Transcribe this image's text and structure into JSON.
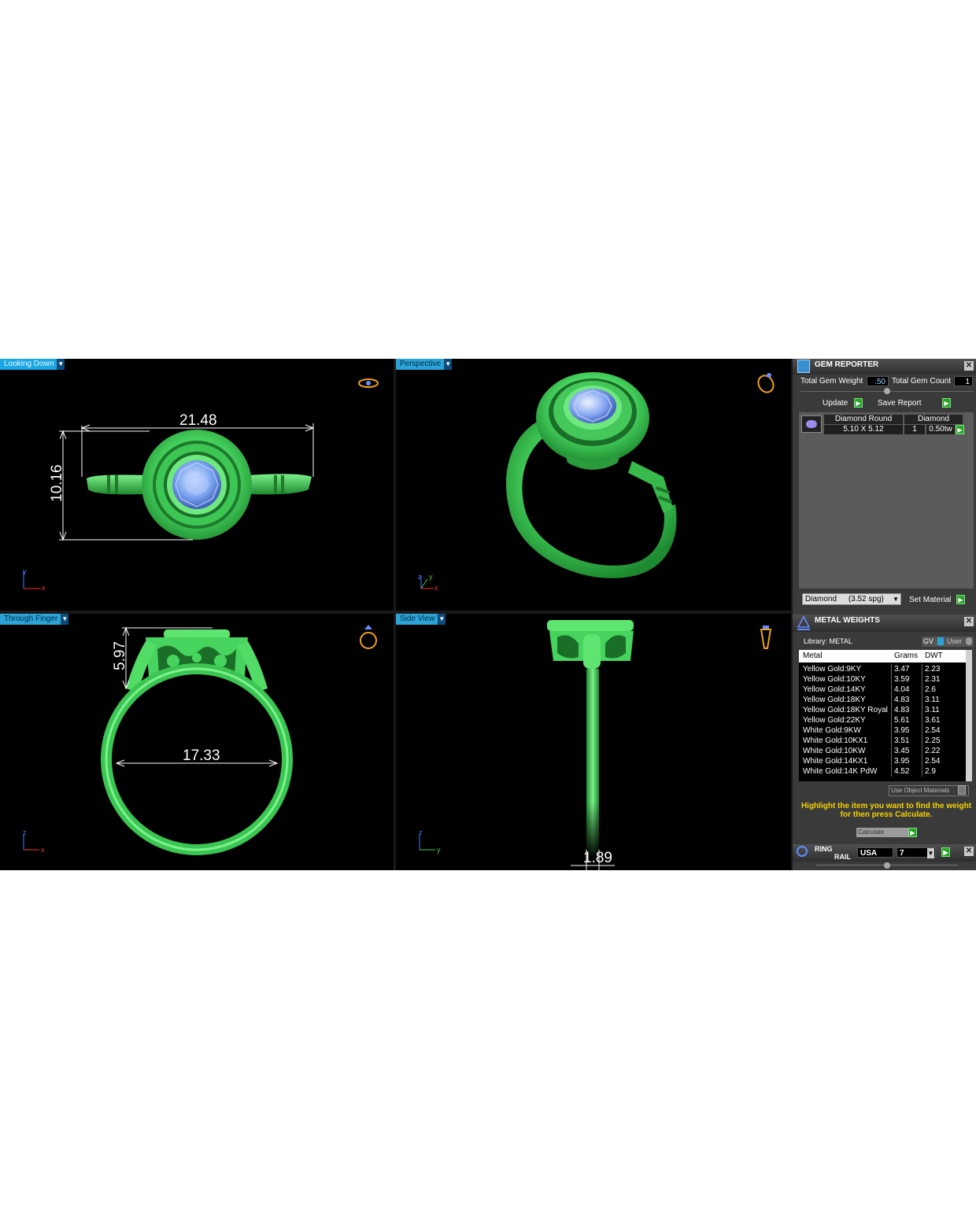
{
  "viewports": {
    "top_left": {
      "label": "Looking Down",
      "dim_width": "21.48",
      "dim_height": "10.16",
      "axis_v": "y",
      "axis_h": "x"
    },
    "top_right": {
      "label": "Perspective",
      "axis_v": "y",
      "axis_h": "x",
      "axis_z": "z"
    },
    "bottom_left": {
      "label": "Through Finger",
      "dim_height": "5.97",
      "dim_width": "17.33",
      "axis_v": "z",
      "axis_h": "x"
    },
    "bottom_right": {
      "label": "Side View",
      "dim_width": "1.89",
      "axis_v": "z",
      "axis_h": "y"
    }
  },
  "gem_reporter": {
    "title": "GEM REPORTER",
    "total_weight_label": "Total Gem Weight",
    "total_weight_value": ".50",
    "total_count_label": "Total Gem Count",
    "total_count_value": "1",
    "update_label": "Update",
    "save_report_label": "Save Report",
    "col1_header": "Diamond Round",
    "col2_header": "Diamond",
    "row_size": "5.10 X 5.12",
    "row_count": "1",
    "row_weight": "0.50tw",
    "material_select": "Diamond",
    "material_sg": "(3.52 spg)",
    "set_material_label": "Set Material"
  },
  "metal_weights": {
    "title": "METAL WEIGHTS",
    "library_label": "Library: METAL",
    "gv_label": "GV",
    "user_label": "User",
    "headers": {
      "metal": "Metal",
      "grams": "Grams",
      "dwt": "DWT"
    },
    "rows": [
      {
        "metal": "Yellow Gold:9KY",
        "grams": "3.47",
        "dwt": "2.23"
      },
      {
        "metal": "Yellow Gold:10KY",
        "grams": "3.59",
        "dwt": "2.31"
      },
      {
        "metal": "Yellow Gold:14KY",
        "grams": "4.04",
        "dwt": "2.6"
      },
      {
        "metal": "Yellow Gold:18KY",
        "grams": "4.83",
        "dwt": "3.11"
      },
      {
        "metal": "Yellow Gold:18KY Royal",
        "grams": "4.83",
        "dwt": "3.11"
      },
      {
        "metal": "Yellow Gold:22KY",
        "grams": "5.61",
        "dwt": "3.61"
      },
      {
        "metal": "White Gold:9KW",
        "grams": "3.95",
        "dwt": "2.54"
      },
      {
        "metal": "White Gold:10KX1",
        "grams": "3.51",
        "dwt": "2.25"
      },
      {
        "metal": "White Gold:10KW",
        "grams": "3.45",
        "dwt": "2.22"
      },
      {
        "metal": "White Gold:14KX1",
        "grams": "3.95",
        "dwt": "2.54"
      },
      {
        "metal": "White Gold:14K PdW",
        "grams": "4.52",
        "dwt": "2.9"
      }
    ],
    "use_object_label": "Use Object Materials",
    "hint": "Highlight the item you want to find the weight for then press Calculate.",
    "calculate_label": "Calculate"
  },
  "ring_rail": {
    "title_line1": "RING",
    "title_line2": "RAIL",
    "standard_value": "USA",
    "size_value": "7"
  },
  "colors": {
    "ring": "#4de06a",
    "gem": "#8fb8ff",
    "accent": "#2ba3d6",
    "hint": "#f5d400"
  }
}
